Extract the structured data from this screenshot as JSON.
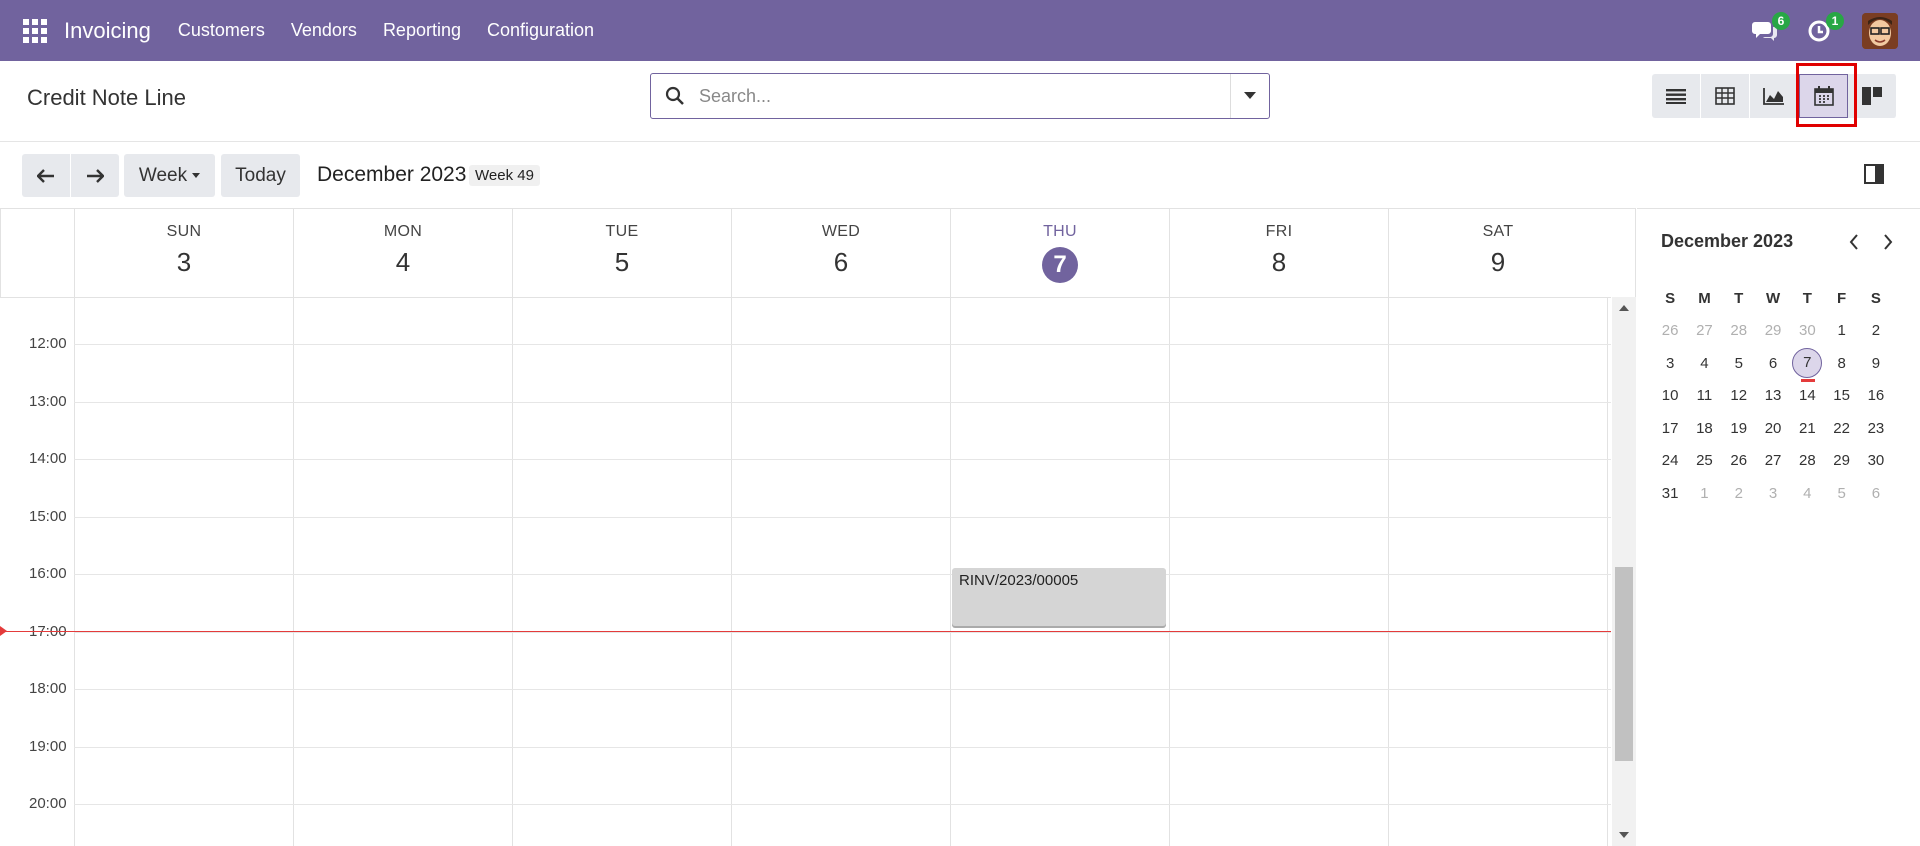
{
  "navbar": {
    "app_name": "Invoicing",
    "menu": [
      "Customers",
      "Vendors",
      "Reporting",
      "Configuration"
    ],
    "messages_badge": "6",
    "activities_badge": "1",
    "accent_color": "#71639e"
  },
  "control_panel": {
    "title": "Credit Note Line",
    "search_placeholder": "Search...",
    "views": [
      "list-icon",
      "pivot-icon",
      "graph-icon",
      "calendar-icon",
      "kanban-icon"
    ],
    "active_view": "calendar"
  },
  "toolbar": {
    "scale_label": "Week",
    "today_label": "Today",
    "range_title": "December 2023",
    "week_label": "Week 49"
  },
  "calendar": {
    "days": [
      {
        "name": "SUN",
        "num": "3"
      },
      {
        "name": "MON",
        "num": "4"
      },
      {
        "name": "TUE",
        "num": "5"
      },
      {
        "name": "WED",
        "num": "6"
      },
      {
        "name": "THU",
        "num": "7"
      },
      {
        "name": "FRI",
        "num": "8"
      },
      {
        "name": "SAT",
        "num": "9"
      }
    ],
    "today_index": 4,
    "hours": [
      "12:00",
      "13:00",
      "14:00",
      "15:00",
      "16:00",
      "17:00",
      "18:00",
      "19:00",
      "20:00"
    ],
    "events": [
      {
        "title": "RINV/2023/00005",
        "day_index": 4,
        "start": "16:00",
        "end": "17:00"
      }
    ],
    "now_time": "17:00"
  },
  "mini_calendar": {
    "title": "December 2023",
    "weekdays": [
      "S",
      "M",
      "T",
      "W",
      "T",
      "F",
      "S"
    ],
    "weeks": [
      [
        "26",
        "27",
        "28",
        "29",
        "30",
        "1",
        "2"
      ],
      [
        "3",
        "4",
        "5",
        "6",
        "7",
        "8",
        "9"
      ],
      [
        "10",
        "11",
        "12",
        "13",
        "14",
        "15",
        "16"
      ],
      [
        "17",
        "18",
        "19",
        "20",
        "21",
        "22",
        "23"
      ],
      [
        "24",
        "25",
        "26",
        "27",
        "28",
        "29",
        "30"
      ],
      [
        "31",
        "1",
        "2",
        "3",
        "4",
        "5",
        "6"
      ]
    ],
    "today": "7"
  }
}
